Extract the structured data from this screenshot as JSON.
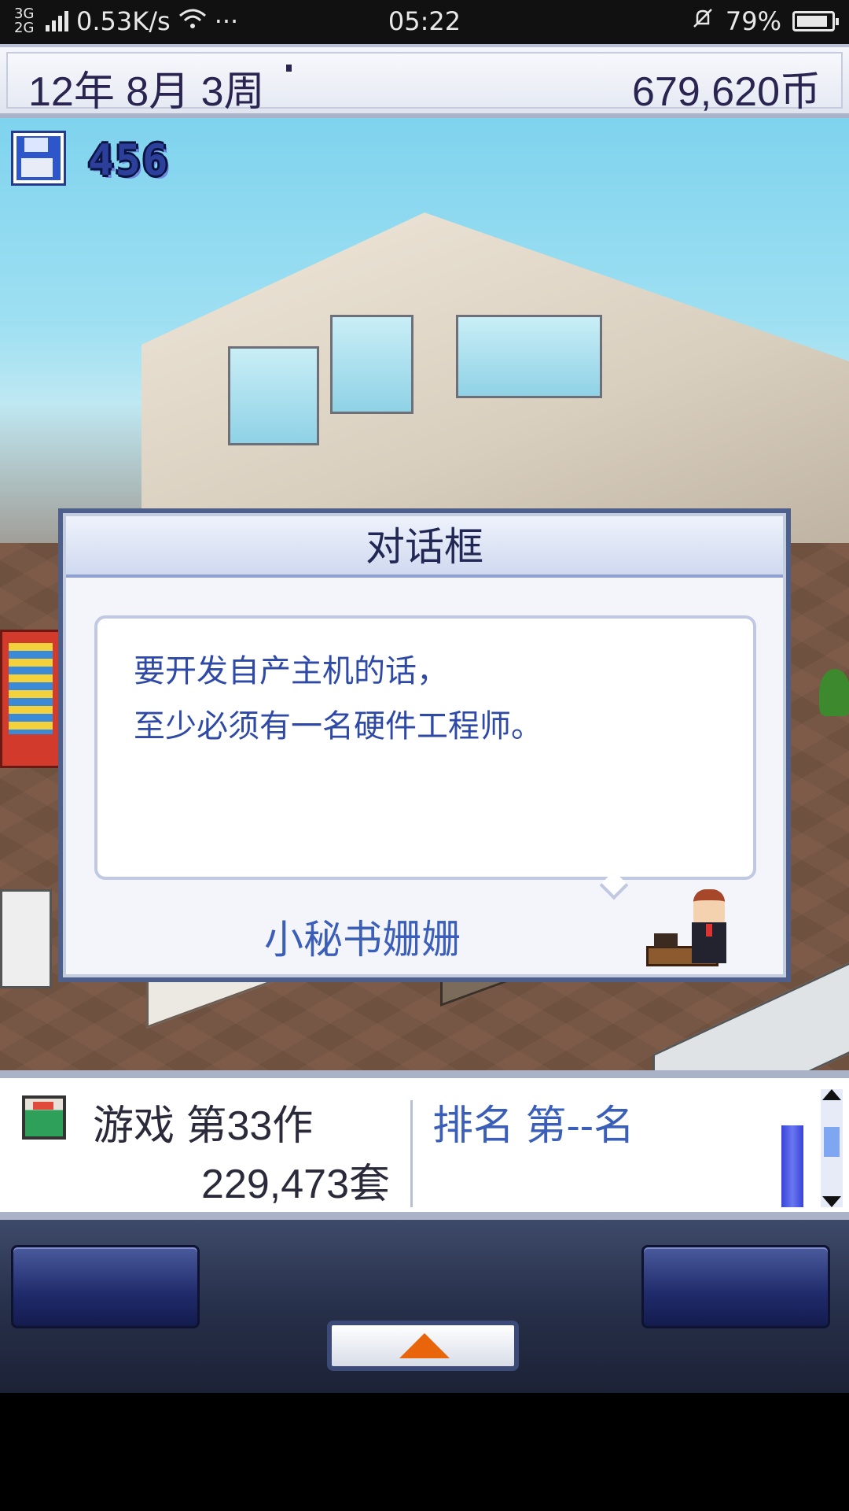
{
  "status_bar": {
    "network": "3G 2G",
    "speed": "0.53K/s",
    "more": "···",
    "time": "05:22",
    "battery": "79%",
    "battery_level": 0.79
  },
  "top_bar": {
    "date": "12年 8月 3周",
    "money": "679,620币"
  },
  "scene": {
    "save_count": "456"
  },
  "dialog": {
    "title": "对话框",
    "message": "要开发自产主机的话，\n至少必须有一名硬件工程师。",
    "speaker": "小秘书姗姗"
  },
  "info_panel": {
    "game_title": "游戏 第33作",
    "sales": "229,473套",
    "rank": "排名 第--名"
  },
  "colors": {
    "dialog_text": "#2f4aa6",
    "speaker_text": "#3b5fb8",
    "menu_arrow": "#e8650c"
  },
  "icons": [
    "save-icon",
    "game-cartridge-icon",
    "up-arrow-icon",
    "wifi-icon",
    "silent-bell-icon",
    "battery-icon"
  ]
}
